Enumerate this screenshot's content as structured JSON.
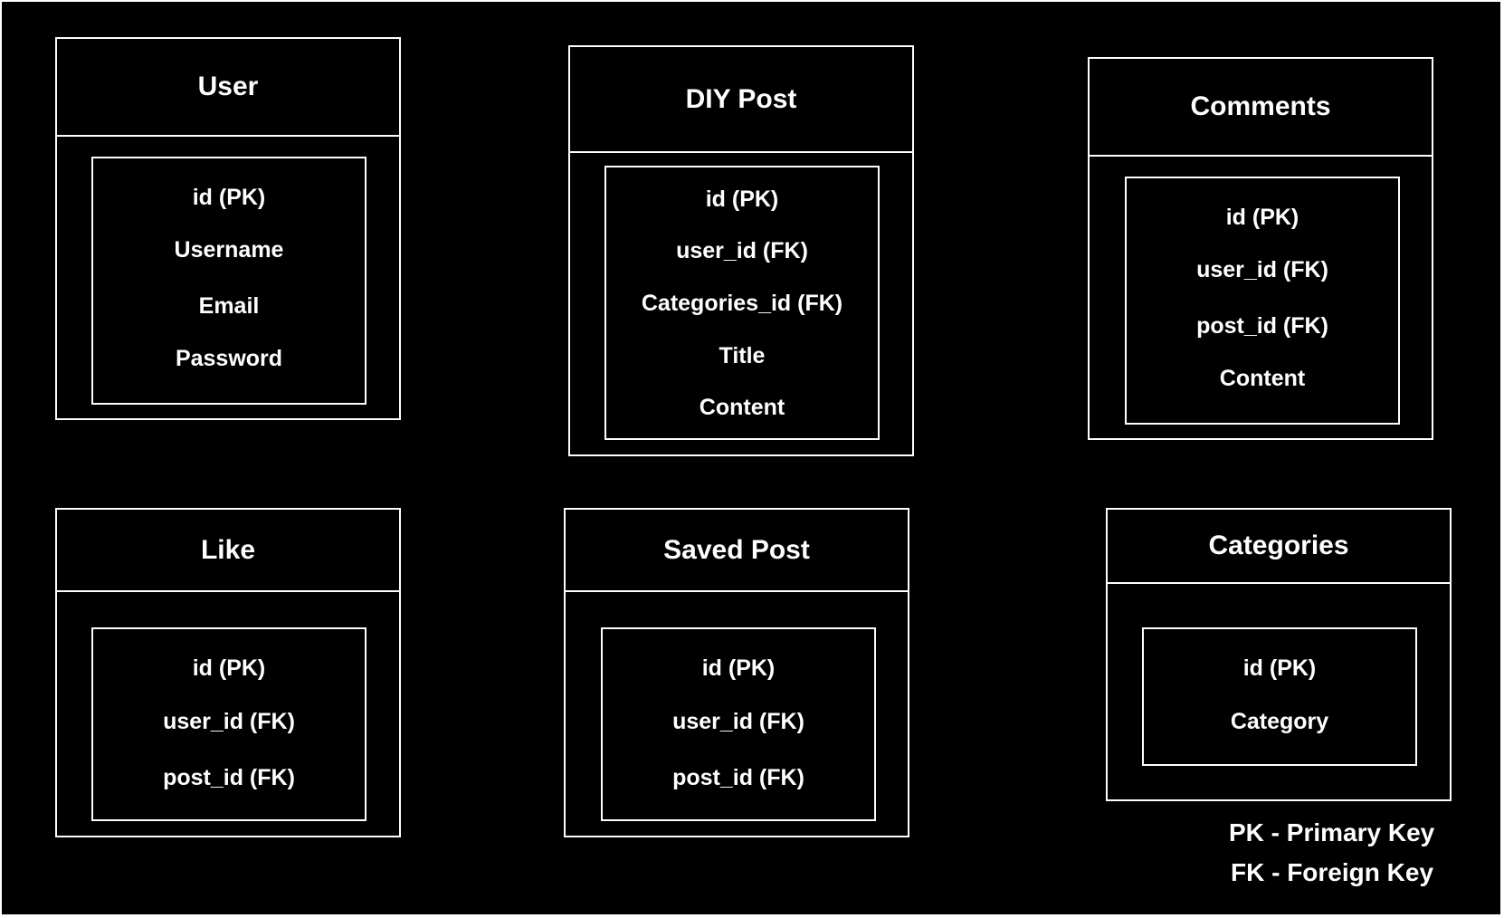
{
  "colors": {
    "background": "#000000",
    "foreground": "#ffffff"
  },
  "entities": [
    {
      "key": "user",
      "title": "User",
      "fields": [
        "id (PK)",
        "Username",
        "Email",
        "Password"
      ]
    },
    {
      "key": "diy-post",
      "title": "DIY Post",
      "fields": [
        "id (PK)",
        "user_id (FK)",
        "Categories_id (FK)",
        "Title",
        "Content"
      ]
    },
    {
      "key": "comments",
      "title": "Comments",
      "fields": [
        "id (PK)",
        "user_id (FK)",
        "post_id (FK)",
        "Content"
      ]
    },
    {
      "key": "like",
      "title": "Like",
      "fields": [
        "id (PK)",
        "user_id (FK)",
        "post_id (FK)"
      ]
    },
    {
      "key": "saved-post",
      "title": "Saved Post",
      "fields": [
        "id (PK)",
        "user_id (FK)",
        "post_id (FK)"
      ]
    },
    {
      "key": "categories",
      "title": "Categories",
      "fields": [
        "id (PK)",
        "Category"
      ]
    }
  ],
  "legend": {
    "pk": "PK - Primary Key",
    "fk": "FK - Foreign Key"
  }
}
